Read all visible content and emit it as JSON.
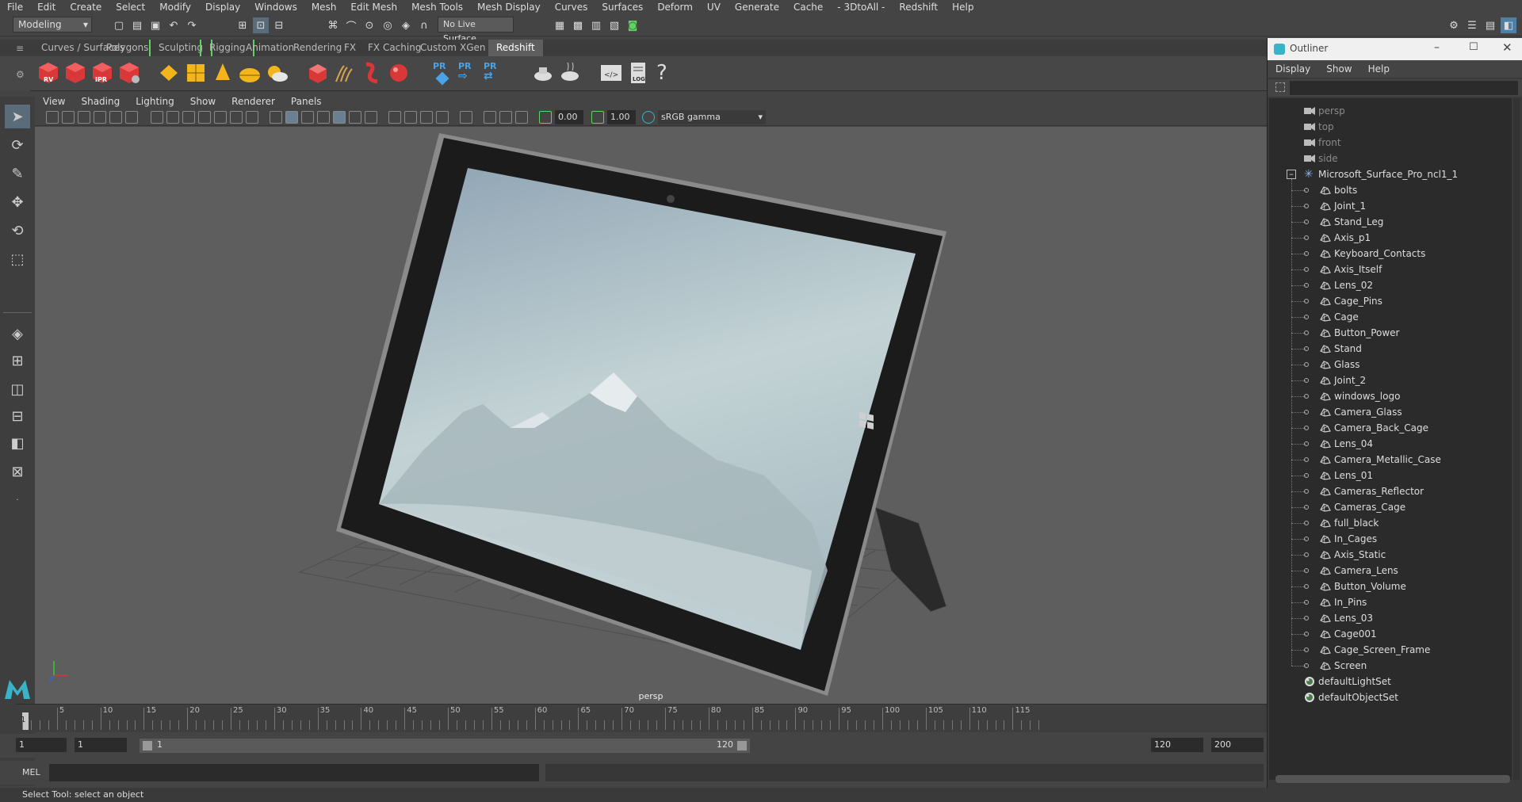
{
  "menubar": [
    "File",
    "Edit",
    "Create",
    "Select",
    "Modify",
    "Display",
    "Windows",
    "Mesh",
    "Edit Mesh",
    "Mesh Tools",
    "Mesh Display",
    "Curves",
    "Surfaces",
    "Deform",
    "UV",
    "Generate",
    "Cache",
    "- 3DtoAll -",
    "Redshift",
    "Help"
  ],
  "statusline": {
    "mode_select": "Modeling",
    "live_surface": "No Live Surface"
  },
  "shelf_tabs": [
    {
      "label": "Curves / Surfaces",
      "active": false
    },
    {
      "label": "Polygons",
      "active": false
    },
    {
      "label": "Sculpting",
      "active": false,
      "bracket": true
    },
    {
      "label": "Rigging",
      "active": false,
      "bracket": true
    },
    {
      "label": "Animation",
      "active": false
    },
    {
      "label": "Rendering",
      "active": false
    },
    {
      "label": "FX",
      "active": false
    },
    {
      "label": "FX Caching",
      "active": false
    },
    {
      "label": "Custom",
      "active": false
    },
    {
      "label": "XGen",
      "active": false
    },
    {
      "label": "Redshift",
      "active": true
    }
  ],
  "shelf_icon_labels": {
    "rv": "RV",
    "ipr": "IPR",
    "pr": "PR",
    "log": "LOG",
    "help": "?"
  },
  "panel_menu": [
    "View",
    "Shading",
    "Lighting",
    "Show",
    "Renderer",
    "Panels"
  ],
  "viewport_tools": {
    "exposure": "0.00",
    "gamma": "1.00",
    "colorspace": "sRGB gamma"
  },
  "viewport": {
    "camera_label": "persp"
  },
  "timeline": {
    "ticks": [
      "1",
      "5",
      "10",
      "15",
      "20",
      "25",
      "30",
      "35",
      "40",
      "45",
      "50",
      "55",
      "60",
      "65",
      "70",
      "75",
      "80",
      "85",
      "90",
      "95",
      "100",
      "105",
      "110",
      "115"
    ],
    "current_frame": "1"
  },
  "range": {
    "start": "1",
    "playback_start": "1",
    "slider_start": "1",
    "slider_end": "120",
    "playback_end": "120",
    "end": "200"
  },
  "cmdline": {
    "label": "MEL"
  },
  "helpline": {
    "text": "Select Tool: select an object"
  },
  "outliner": {
    "title": "Outliner",
    "menu": [
      "Display",
      "Show",
      "Help"
    ],
    "cameras": [
      "persp",
      "top",
      "front",
      "side"
    ],
    "group": "Microsoft_Surface_Pro_ncl1_1",
    "children": [
      "bolts",
      "Joint_1",
      "Stand_Leg",
      "Axis_p1",
      "Keyboard_Contacts",
      "Axis_Itself",
      "Lens_02",
      "Cage_Pins",
      "Cage",
      "Button_Power",
      "Stand",
      "Glass",
      "Joint_2",
      "windows_logo",
      "Camera_Glass",
      "Camera_Back_Cage",
      "Lens_04",
      "Camera_Metallic_Case",
      "Lens_01",
      "Cameras_Reflector",
      "Cameras_Cage",
      "full_black",
      "In_Cages",
      "Axis_Static",
      "Camera_Lens",
      "Button_Volume",
      "In_Pins",
      "Lens_03",
      "Cage001",
      "Cage_Screen_Frame",
      "Screen"
    ],
    "sets": [
      "defaultLightSet",
      "defaultObjectSet"
    ]
  },
  "colors": {
    "accent_green": "#5fd35f",
    "active_tab": "#5e5e5e",
    "viewport_bg": "#5e5e5e",
    "maya_blue": "#3ab3c8"
  }
}
